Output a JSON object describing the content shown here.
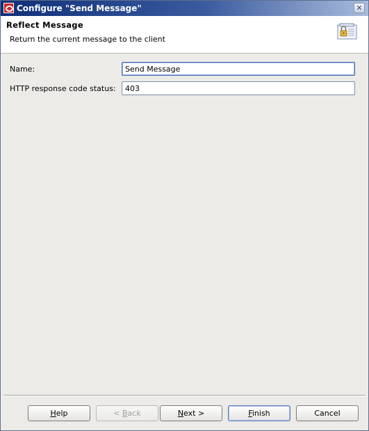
{
  "window": {
    "title": "Configure \"Send Message\"",
    "close_glyph": "✕"
  },
  "header": {
    "title": "Reflect Message",
    "description": "Return the current message to the client",
    "icon": "clipboard-lock-icon"
  },
  "form": {
    "name_label": "Name:",
    "name_value": "Send Message",
    "status_label": "HTTP response code status:",
    "status_value": "403"
  },
  "buttons": {
    "help": {
      "mnemonic": "H",
      "rest": "elp"
    },
    "back": {
      "prefix": "< ",
      "mnemonic": "B",
      "rest": "ack",
      "enabled": false
    },
    "next": {
      "mnemonic": "N",
      "rest": "ext >"
    },
    "finish": {
      "mnemonic": "F",
      "rest": "inish"
    },
    "cancel": {
      "label": "Cancel"
    }
  },
  "colors": {
    "titlebar_start": "#0f2f78",
    "titlebar_end": "#a9bcdc",
    "dialog_bg": "#ecebe8",
    "app_icon": "#c8282d"
  }
}
